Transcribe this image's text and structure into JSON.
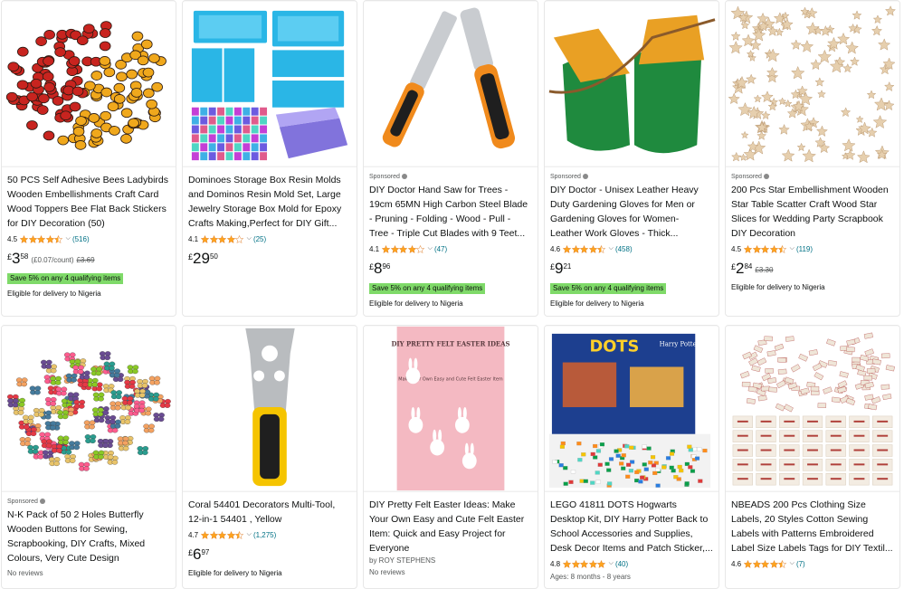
{
  "products": [
    {
      "sponsored": "",
      "title": "50 PCS Self Adhesive Bees Ladybirds Wooden Embellishments Craft Card Wood Toppers Bee Flat Back Stickers for DIY Decoration (50)",
      "rating": "4.5",
      "stars": 4.5,
      "reviews": "(516)",
      "price_currency": "£",
      "price_whole": "3",
      "price_fraction": "58",
      "unit_price": "(£0.07/count)",
      "was_price": "£3.69",
      "promo": "Save 5% on any 4 qualifying items",
      "delivery": "Eligible for delivery to Nigeria",
      "image": "ladybirds-bees-image"
    },
    {
      "sponsored": "",
      "title": "Dominoes Storage Box Resin Molds and Dominos Resin Mold Set, Large Jewelry Storage Box Mold for Epoxy Crafts Making,Perfect for DIY Gift...",
      "rating": "4.1",
      "stars": 4.0,
      "reviews": "(25)",
      "price_currency": "£",
      "price_whole": "29",
      "price_fraction": "50",
      "image": "resin-molds-image"
    },
    {
      "sponsored": "Sponsored",
      "title": "DIY Doctor Hand Saw for Trees - 19cm 65MN High Carbon Steel Blade - Pruning - Folding - Wood - Pull - Tree - Triple Cut Blades with 9 Teet...",
      "rating": "4.1",
      "stars": 4.0,
      "reviews": "(47)",
      "price_currency": "£",
      "price_whole": "8",
      "price_fraction": "96",
      "promo": "Save 5% on any 4 qualifying items",
      "delivery": "Eligible for delivery to Nigeria",
      "image": "hand-saw-image"
    },
    {
      "sponsored": "Sponsored",
      "title": "DIY Doctor - Unisex Leather Heavy Duty Gardening Gloves for Men or Gardening Gloves for Women- Leather Work Gloves - Thick...",
      "rating": "4.6",
      "stars": 4.5,
      "reviews": "(458)",
      "price_currency": "£",
      "price_whole": "9",
      "price_fraction": "21",
      "promo": "Save 5% on any 4 qualifying items",
      "delivery": "Eligible for delivery to Nigeria",
      "image": "gardening-gloves-image"
    },
    {
      "sponsored": "Sponsored",
      "title": "200 Pcs Star Embellishment Wooden Star Table Scatter Craft Wood Star Slices for Wedding Party Scrapbook DIY Decoration",
      "rating": "4.5",
      "stars": 4.5,
      "reviews": "(119)",
      "price_currency": "£",
      "price_whole": "2",
      "price_fraction": "84",
      "was_price": "£3.30",
      "delivery": "Eligible for delivery to Nigeria",
      "image": "wooden-stars-image"
    },
    {
      "sponsored": "Sponsored",
      "title": "N-K Pack of 50 2 Holes Butterfly Wooden Buttons for Sewing, Scrapbooking, DIY Crafts, Mixed Colours, Very Cute Design",
      "no_reviews": "No reviews",
      "image": "butterfly-buttons-image"
    },
    {
      "sponsored": "",
      "title": "Coral 54401 Decorators Multi-Tool, 12-in-1 54401 , Yellow",
      "rating": "4.7",
      "stars": 4.5,
      "reviews": "(1,275)",
      "price_currency": "£",
      "price_whole": "6",
      "price_fraction": "97",
      "delivery": "Eligible for delivery to Nigeria",
      "image": "multi-tool-image"
    },
    {
      "sponsored": "",
      "title": "DIY Pretty Felt Easter Ideas: Make Your Own Easy and Cute Felt Easter Item: Quick and Easy Project for Everyone",
      "author": "by ROY STEPHENS",
      "no_reviews": "No reviews",
      "cover_text": "DIY PRETTY FELT EASTER IDEAS",
      "cover_sub": "Make Your Own Easy and Cute Felt Easter Item",
      "image": "book-cover-image"
    },
    {
      "sponsored": "",
      "title": "LEGO 41811 DOTS Hogwarts Desktop Kit, DIY Harry Potter Back to School Accessories and Supplies, Desk Decor Items and Patch Sticker,...",
      "rating": "4.8",
      "stars": 5.0,
      "reviews": "(40)",
      "ages": "Ages: 8 months - 8 years",
      "box_brand": "DOTS",
      "box_sub": "Harry Potter",
      "image": "lego-dots-image"
    },
    {
      "sponsored": "",
      "title": "NBEADS 200 Pcs Clothing Size Labels, 20 Styles Cotton Sewing Labels with Patterns Embroidered Label Size Labels Tags for DIY Textil...",
      "rating": "4.6",
      "stars": 4.5,
      "reviews": "(7)",
      "image": "sewing-labels-image"
    }
  ],
  "colors": {
    "star": "#ffa41c",
    "link": "#007185",
    "promo_bg": "#7fda69"
  }
}
